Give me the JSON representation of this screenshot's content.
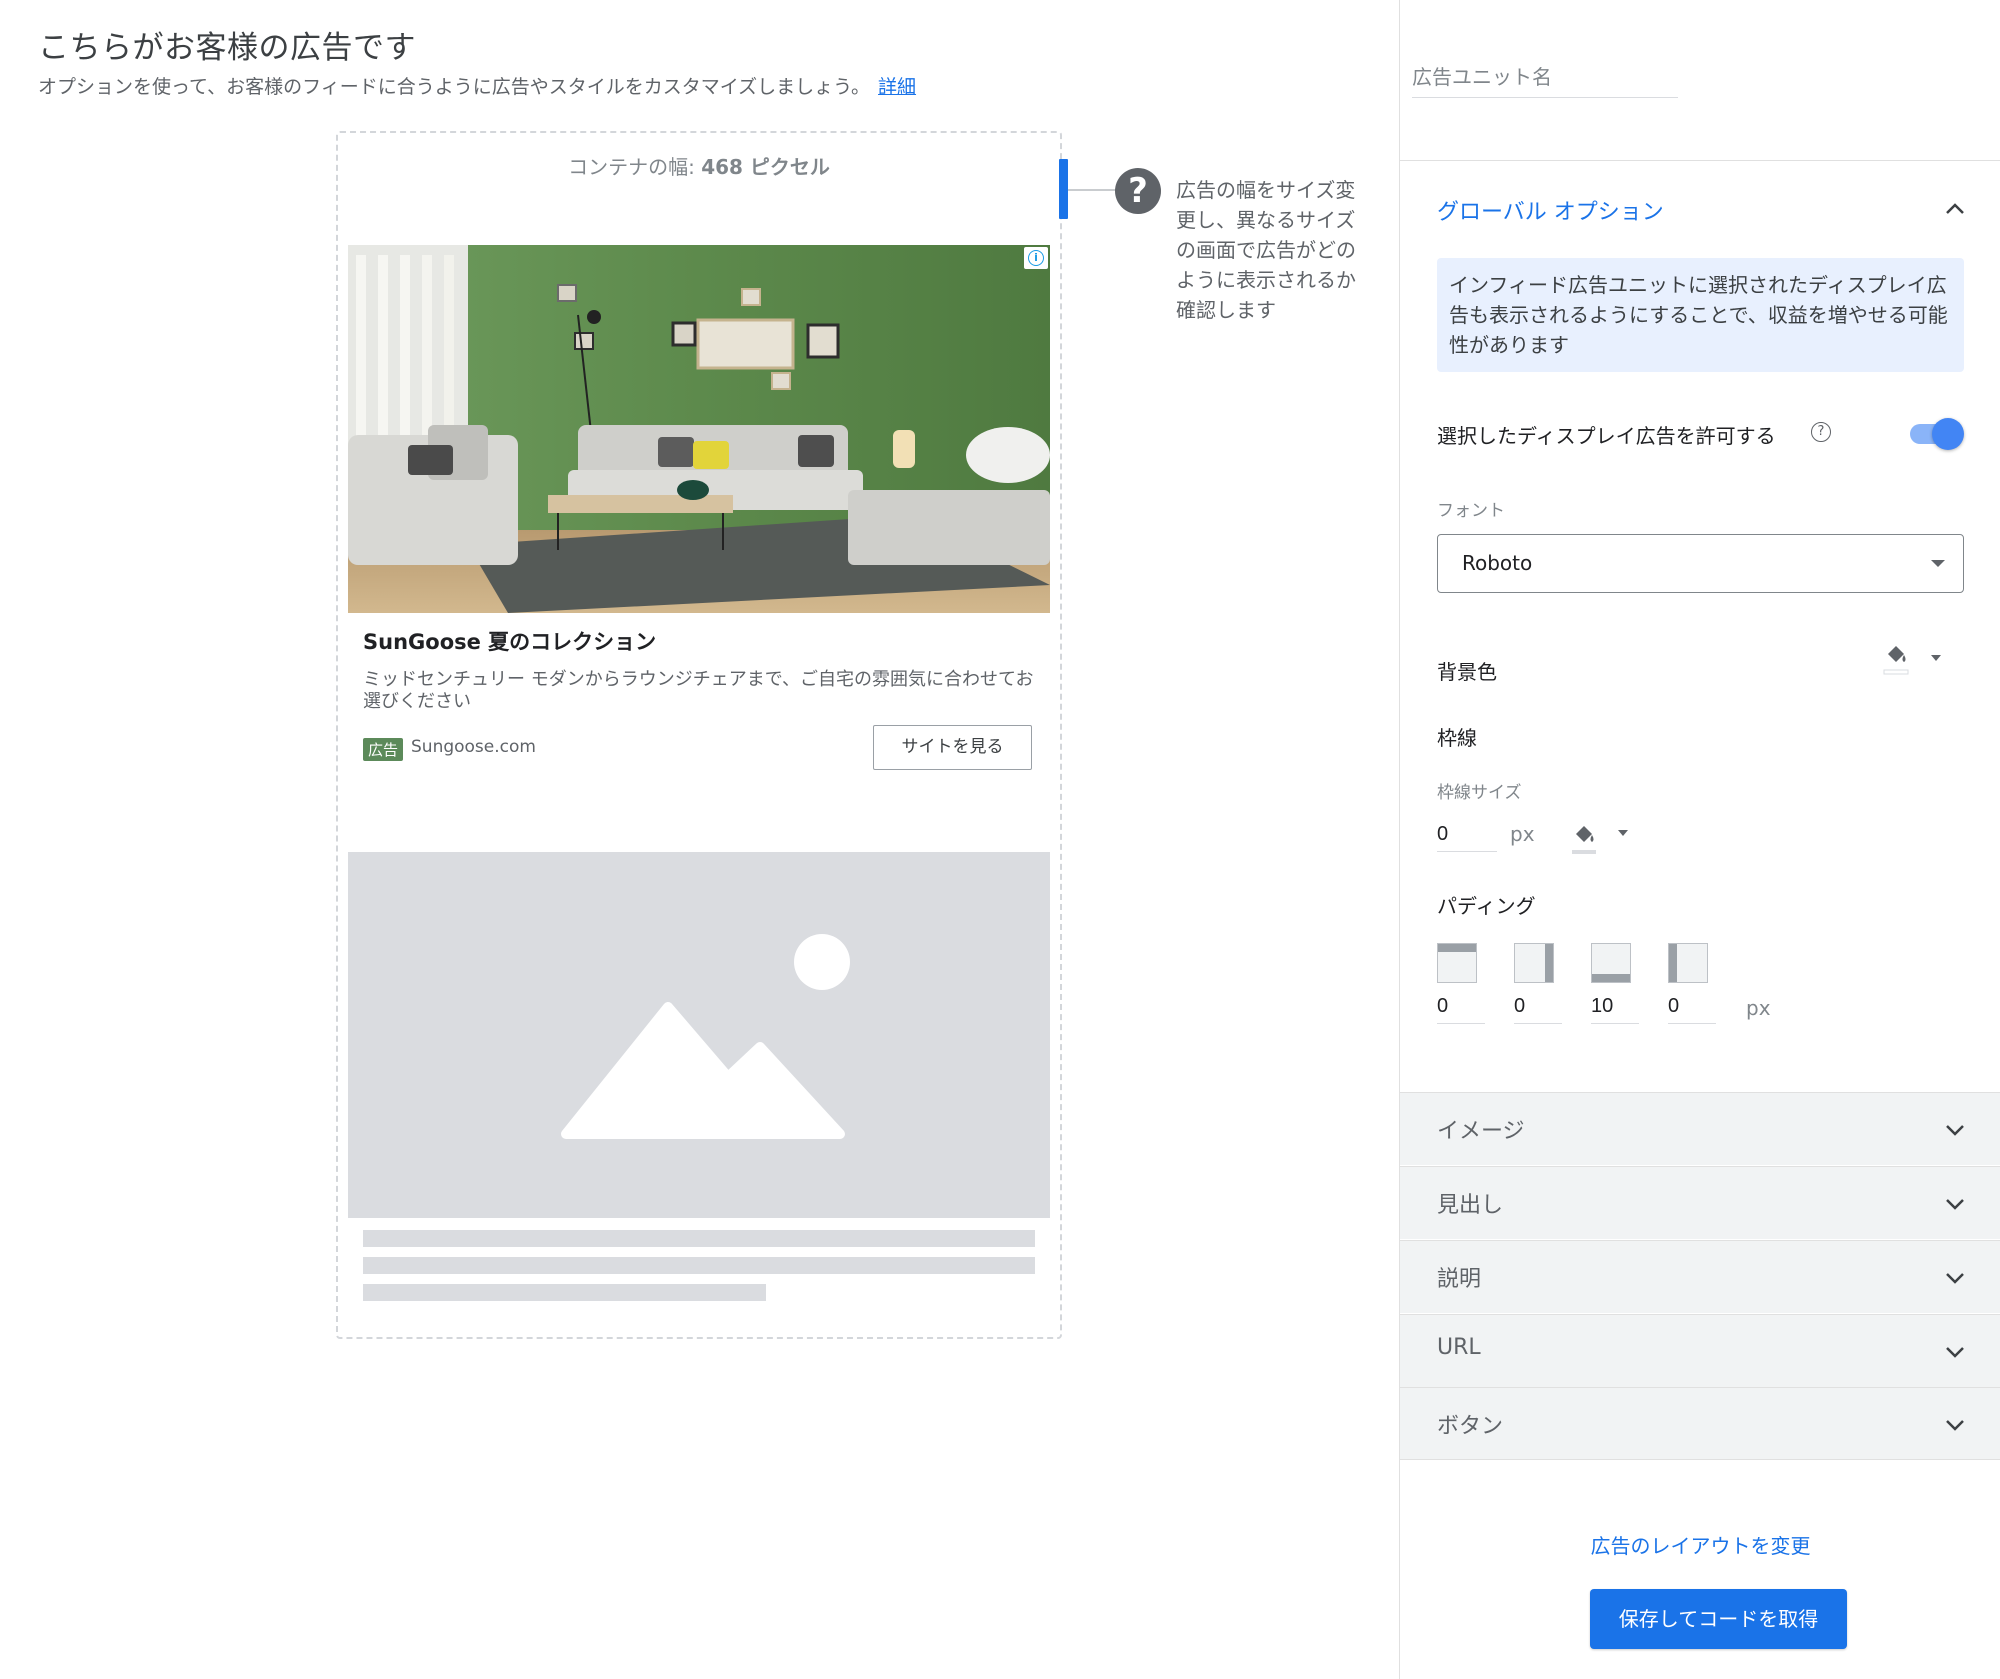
{
  "header": {
    "title": "こちらがお客様の広告です",
    "subtitle": "オプションを使って、お客様のフィードに合うように広告やスタイルをカスタマイズしましょう。",
    "details_link": "詳細"
  },
  "preview": {
    "width_label": "コンテナの幅:",
    "width_value": "468 ピクセル",
    "help_text": "広告の幅をサイズ変更し、異なるサイズの画面で広告がどのように表示されるか確認します",
    "ad": {
      "headline": "SunGoose 夏のコレクション",
      "description": "ミッドセンチュリー モダンからラウンジチェアまで、ご自宅の雰囲気に合わせてお選びください",
      "badge": "広告",
      "url": "Sungoose.com",
      "button": "サイトを見る"
    }
  },
  "panel": {
    "unit_name_placeholder": "広告ユニット名",
    "global_options": {
      "title": "グローバル オプション",
      "info": "インフィード広告ユニットに選択されたディスプレイ広告も表示されるようにすることで、収益を増やせる可能性があります",
      "toggle_label": "選択したディスプレイ広告を許可する",
      "toggle_on": true,
      "font_label": "フォント",
      "font_value": "Roboto",
      "bg_color_label": "背景色",
      "border_label": "枠線",
      "border_size_label": "枠線サイズ",
      "border_size_value": "0",
      "border_unit": "px",
      "padding_label": "パディング",
      "padding": {
        "top": "0",
        "right": "0",
        "bottom": "10",
        "left": "0"
      },
      "padding_unit": "px"
    },
    "sections": [
      "イメージ",
      "見出し",
      "説明",
      "URL",
      "ボタン"
    ],
    "change_layout": "広告のレイアウトを変更",
    "save_button": "保存してコードを取得"
  },
  "colors": {
    "accent": "#1a73e8",
    "info_bg": "#e8f0fe",
    "placeholder": "#dadce0"
  }
}
